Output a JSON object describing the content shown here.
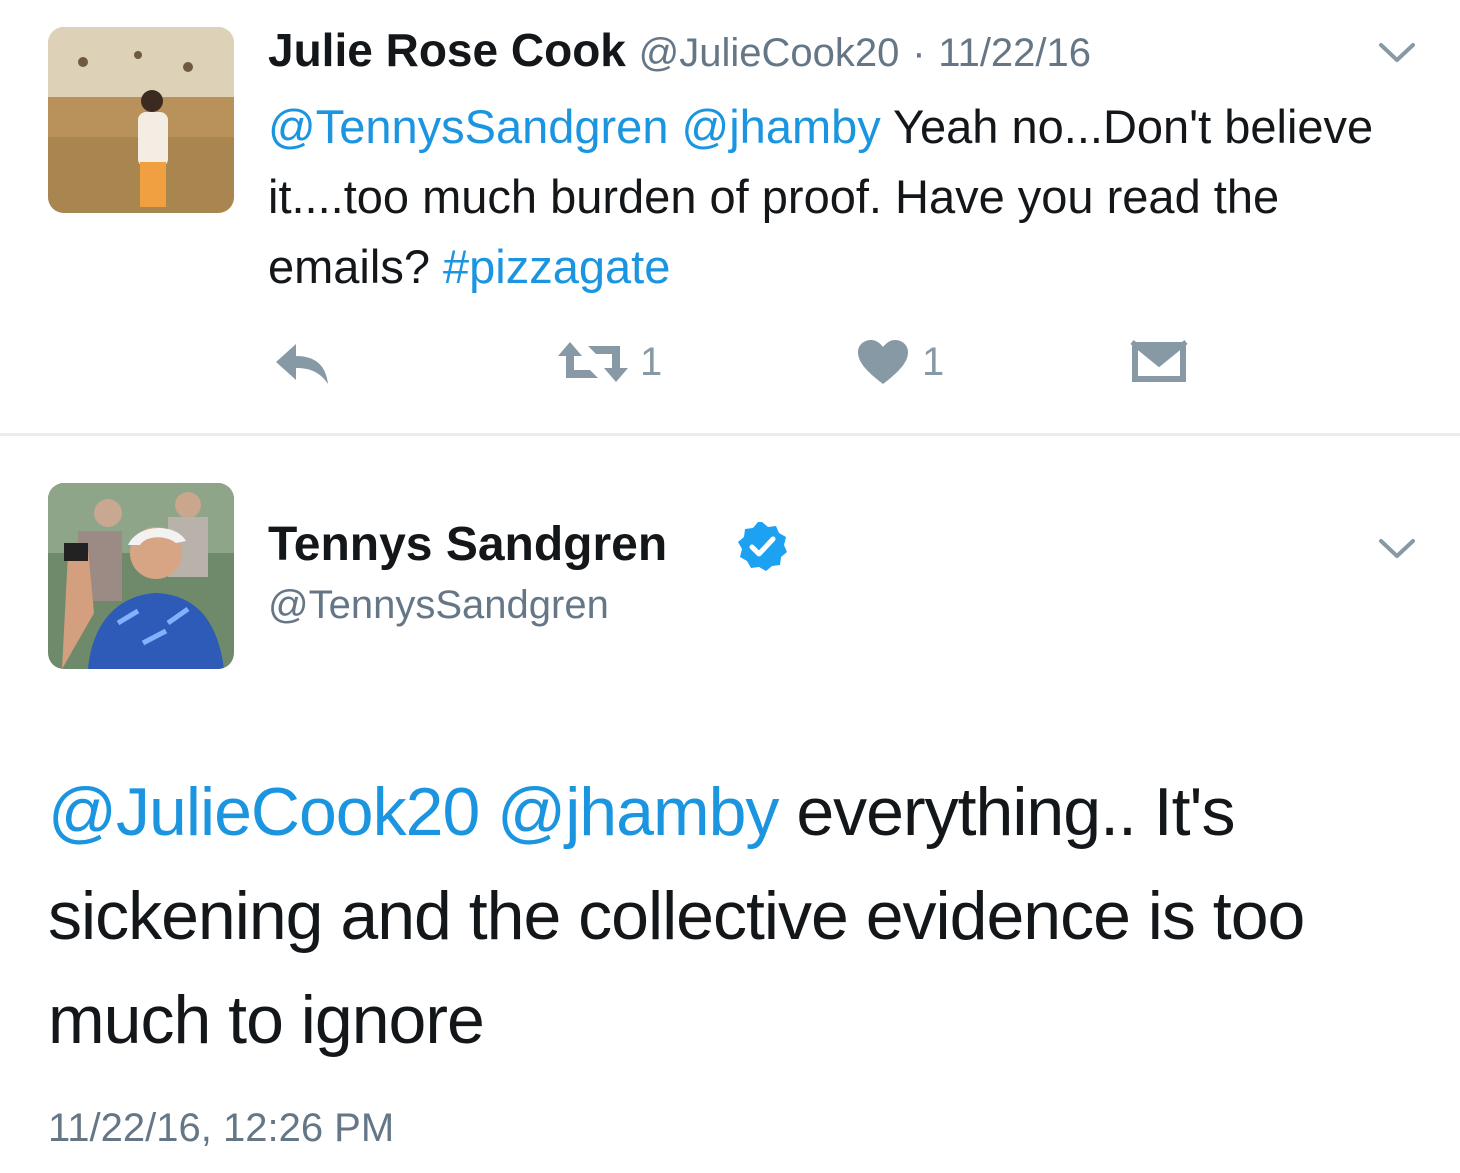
{
  "reply_tweet": {
    "display_name": "Julie Rose Cook",
    "handle": "@JulieCook20",
    "separator": "·",
    "date": "11/22/16",
    "mention_1": "@TennysSandgren",
    "mention_2": "@jhamby",
    "text": "Yeah no...Don't believe it....too much burden of proof. Have you read the emails?",
    "hashtag": "#pizzagate",
    "retweet_count": "1",
    "like_count": "1",
    "icons": [
      "reply-icon",
      "retweet-icon",
      "heart-icon",
      "message-icon",
      "chevron-down-icon"
    ]
  },
  "main_tweet": {
    "display_name": "Tennys Sandgren",
    "handle": "@TennysSandgren",
    "mention_1": "@JulieCook20",
    "mention_2": "@jhamby",
    "text": "everything.. It's sickening and the collective evidence is too much to ignore",
    "timestamp": "11/22/16, 12:26 PM",
    "icons": [
      "verified-badge-icon",
      "chevron-down-icon"
    ]
  },
  "colors": {
    "link": "#1b95e0",
    "muted": "#657786",
    "icon": "#8899a6",
    "divider": "#e6ecf0"
  }
}
